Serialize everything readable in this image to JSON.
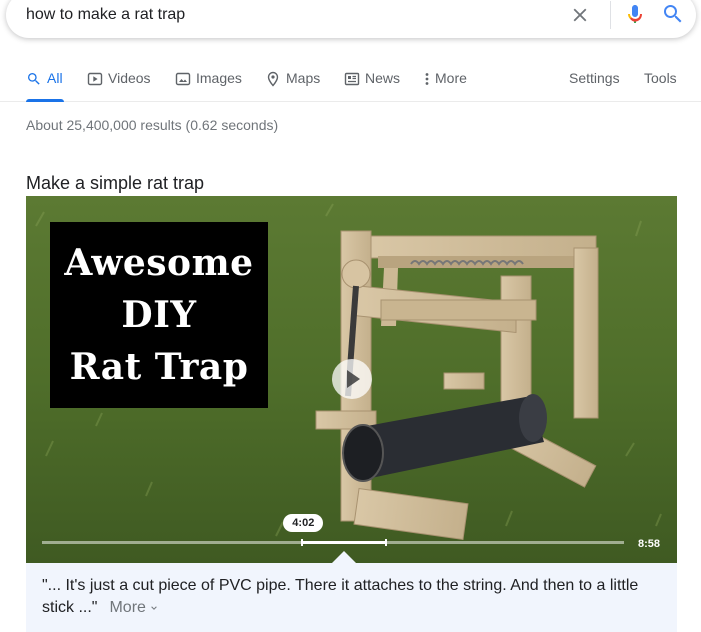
{
  "search": {
    "query": "how to make a rat trap"
  },
  "tabs": [
    {
      "label": "All",
      "icon": "search-icon",
      "active": true
    },
    {
      "label": "Videos",
      "icon": "video-icon"
    },
    {
      "label": "Images",
      "icon": "image-icon"
    },
    {
      "label": "Maps",
      "icon": "map-pin-icon"
    },
    {
      "label": "News",
      "icon": "news-icon"
    },
    {
      "label": "More",
      "icon": "more-vert-icon"
    }
  ],
  "tools": {
    "settings_label": "Settings",
    "tools_label": "Tools"
  },
  "stats": "About 25,400,000 results (0.62 seconds)",
  "video": {
    "title": "Make a simple rat trap",
    "thumbnail_lines": [
      "Awesome",
      "DIY",
      "Rat Trap"
    ],
    "clip_start_label": "4:02",
    "duration": "8:58",
    "clip_start_fraction": 0.449,
    "clip_end_fraction": 0.59
  },
  "quote": {
    "text": "\"... It's just a cut piece of PVC pipe. There it attaches to the string. And then to a little stick ...\"",
    "more_label": "More"
  },
  "colors": {
    "accent": "#1a73e8",
    "quote_bg": "#f1f5fd"
  }
}
